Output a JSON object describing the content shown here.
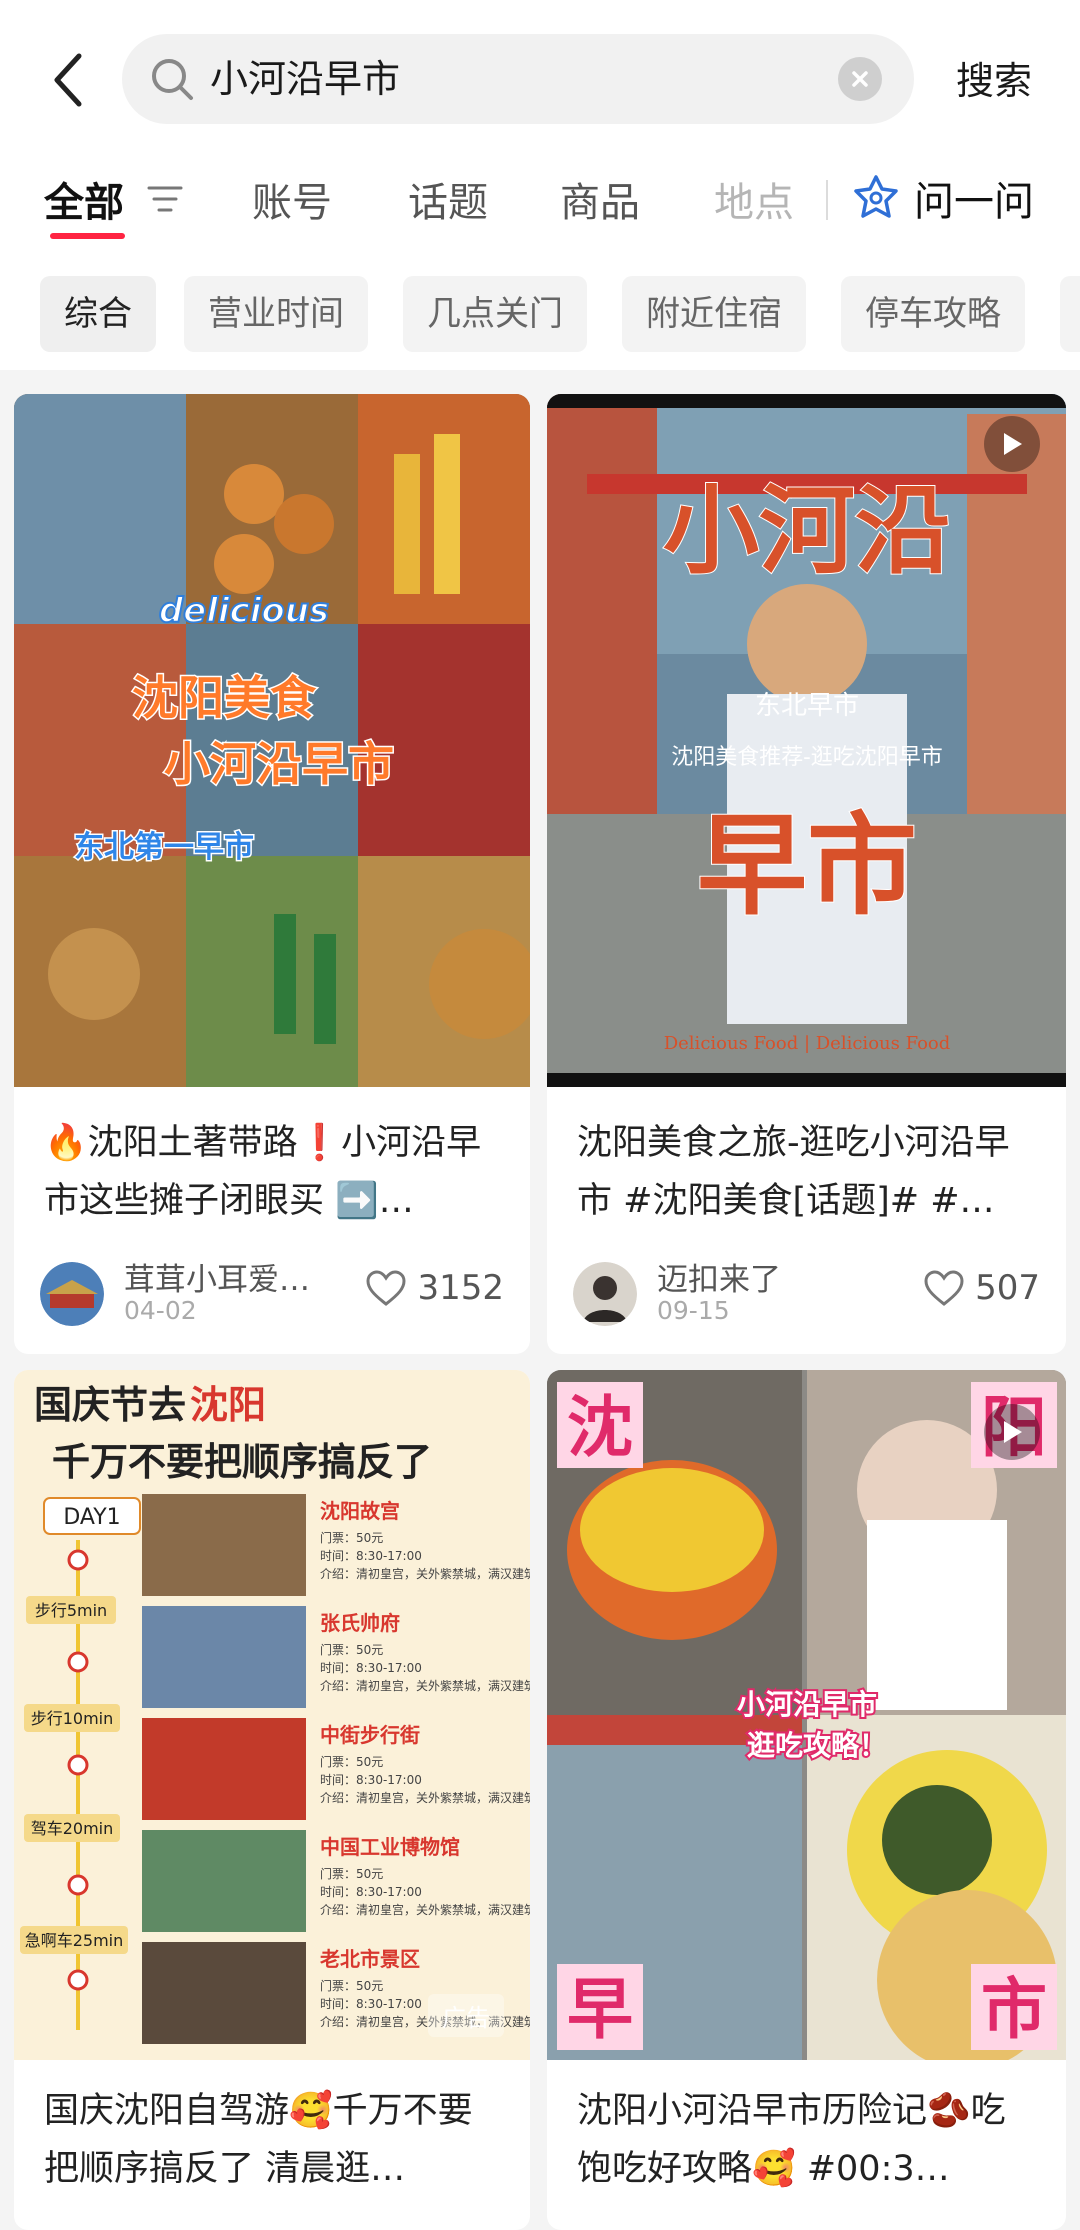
{
  "search": {
    "query": "小河沿早市",
    "button": "搜索"
  },
  "tabs": [
    "全部",
    "账号",
    "话题",
    "商品",
    "地点"
  ],
  "ask_label": "问一问",
  "chips": [
    "综合",
    "营业时间",
    "几点关门",
    "附近住宿",
    "停车攻略"
  ],
  "colors": {
    "accent": "#ff2442",
    "chip_bg": "#f3f3f3",
    "page_bg": "#f4f4f4"
  },
  "cards": [
    {
      "overlay_lines": [
        "delicious",
        "沈阳美食",
        "小河沿早市",
        "东北第一早市"
      ],
      "title": "🔥沈阳土著带路❗️小河沿早市这些摊子闭眼买 ➡️…",
      "author": "茸茸小耳爱…",
      "date": "04-02",
      "likes": "3152"
    },
    {
      "overlay_lines": [
        "小河沿",
        "东北早市",
        "沈阳美食推荐-逛吃沈阳早市",
        "早市",
        "Delicious Food | Delicious Food"
      ],
      "title": "沈阳美食之旅-逛吃小河沿早市 #沈阳美食[话题]# #…",
      "author": "迈扣来了",
      "date": "09-15",
      "likes": "507"
    },
    {
      "overlay_heading": [
        "国庆节去",
        "沈阳",
        "千万不要把顺序搞反了"
      ],
      "day": "DAY1",
      "steps": [
        "步行5min",
        "步行10min",
        "驾车20min",
        "急啊车25min"
      ],
      "spots": [
        "沈阳故宫",
        "张氏帅府",
        "中街步行街",
        "中国工业博物馆",
        "老北市景区"
      ],
      "spot_lines": [
        "门票：50元",
        "时间：8:30-17:00",
        "介绍：清初皇宫，关外紫禁城，满汉建筑杰作。"
      ],
      "ad_label": "广告",
      "title": "国庆沈阳自驾游🥰千万不要把顺序搞反了 清晨逛…"
    },
    {
      "overlay_corners": [
        "沈",
        "阳",
        "早",
        "市"
      ],
      "overlay_caption": [
        "小河沿早市",
        "逛吃攻略！"
      ],
      "title": "沈阳小河沿早市历险记🫘吃饱吃好攻略🥰 #00:3…"
    }
  ]
}
